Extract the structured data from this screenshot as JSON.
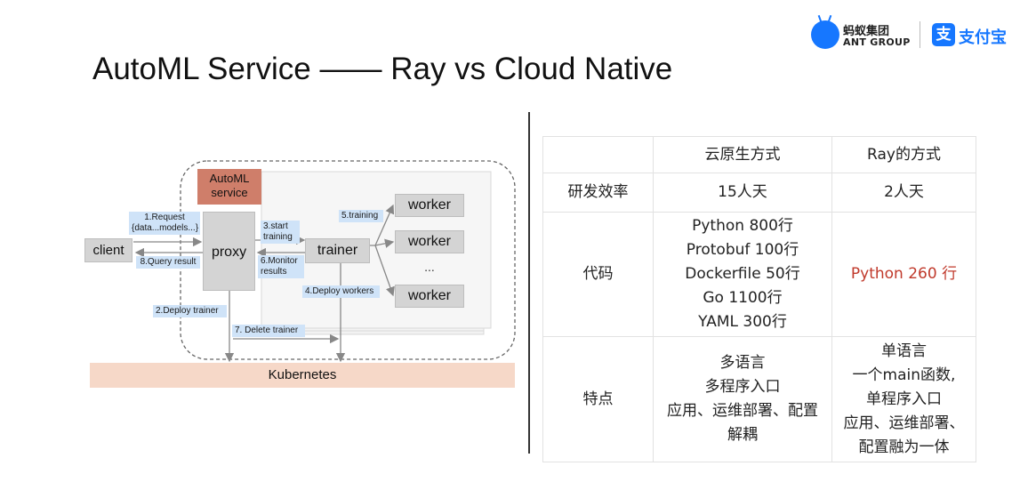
{
  "title": "AutoML Service —— Ray vs Cloud Native",
  "logo": {
    "ant_cn": "蚂蚁集团",
    "ant_en": "ANT GROUP",
    "alipay_mark": "支",
    "alipay_cn": "支付宝"
  },
  "diagram": {
    "automl_service": "AutoML\nservice",
    "client": "client",
    "proxy": "proxy",
    "trainer": "trainer",
    "workers": [
      "worker",
      "worker",
      "worker"
    ],
    "ellipsis": "...",
    "kubernetes": "Kubernetes",
    "edges": {
      "request": "1.Request\n{data...models...}",
      "query_result": "8.Query result",
      "start_training": "3.start\ntraining",
      "monitor_results": "6.Monitor\nresults",
      "training": "5.training",
      "deploy_workers": "4.Deploy workers",
      "deploy_trainer": "2.Deploy trainer",
      "delete_trainer": "7. Delete trainer"
    }
  },
  "table": {
    "header": [
      "",
      "云原生方式",
      "Ray的方式"
    ],
    "rows": [
      {
        "label": "研发效率",
        "cloud_native": [
          "15人天"
        ],
        "ray": [
          "2人天"
        ]
      },
      {
        "label": "代码",
        "cloud_native": [
          "Python 800行",
          "Protobuf 100行",
          "Dockerfile 50行",
          "Go 1100行",
          "YAML 300行"
        ],
        "ray": [
          "Python 260 行"
        ]
      },
      {
        "label": "特点",
        "cloud_native": [
          "多语言",
          "多程序入口",
          "应用、运维部署、配置",
          "解耦"
        ],
        "ray": [
          "单语言",
          "一个main函数,",
          "单程序入口",
          "应用、运维部署、",
          "配置融为一体"
        ]
      }
    ],
    "highlight_color": "#c0392b"
  }
}
